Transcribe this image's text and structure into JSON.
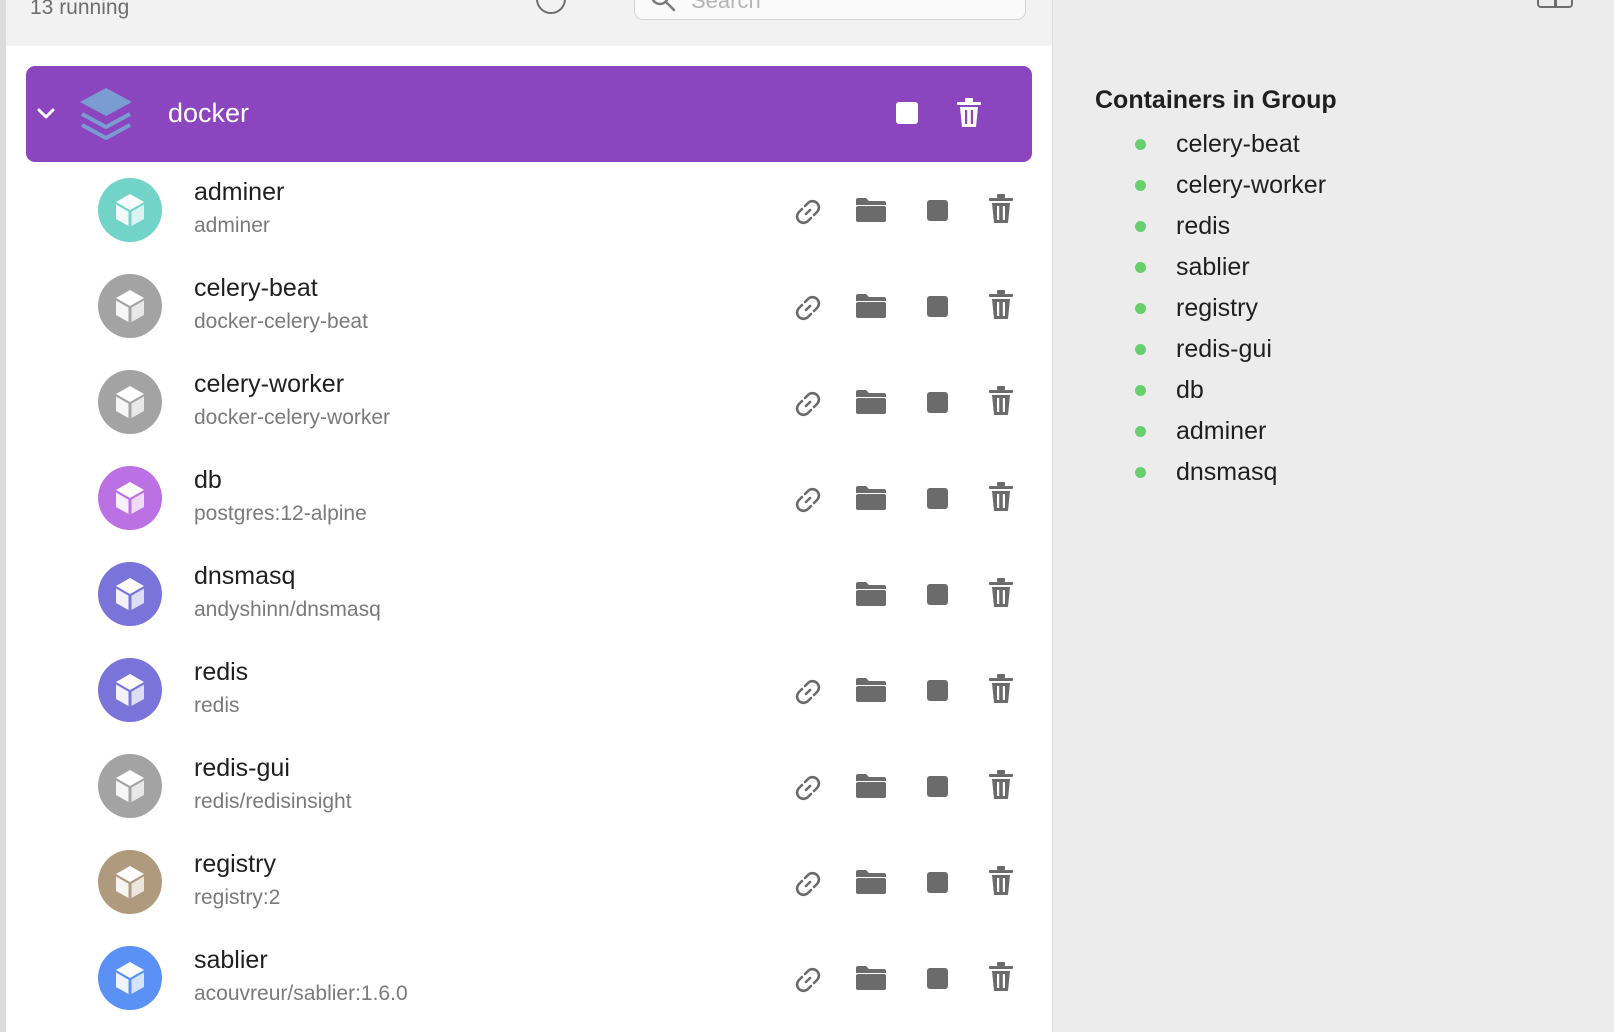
{
  "toolbar": {
    "running_label": "13 running",
    "search_placeholder": "Search",
    "filter_icon": "filter-icon",
    "search_icon": "search-icon"
  },
  "group": {
    "name": "docker",
    "color": "#8b45bf",
    "chevron_icon": "chevron-down-icon",
    "stack_icon": "stack-layers-icon"
  },
  "containers": [
    {
      "name": "adminer",
      "image": "adminer",
      "color": "#72d4c9",
      "has_link": true
    },
    {
      "name": "celery-beat",
      "image": "docker-celery-beat",
      "color": "#a3a3a3",
      "has_link": true
    },
    {
      "name": "celery-worker",
      "image": "docker-celery-worker",
      "color": "#a3a3a3",
      "has_link": true
    },
    {
      "name": "db",
      "image": "postgres:12-alpine",
      "color": "#bb71e3",
      "has_link": true
    },
    {
      "name": "dnsmasq",
      "image": "andyshinn/dnsmasq",
      "color": "#7a73da",
      "has_link": false
    },
    {
      "name": "redis",
      "image": "redis",
      "color": "#7a73da",
      "has_link": true
    },
    {
      "name": "redis-gui",
      "image": "redis/redisinsight",
      "color": "#a3a3a3",
      "has_link": true
    },
    {
      "name": "registry",
      "image": "registry:2",
      "color": "#b09a7e",
      "has_link": true
    },
    {
      "name": "sablier",
      "image": "acouvreur/sablier:1.6.0",
      "color": "#5b91f5",
      "has_link": true
    }
  ],
  "details": {
    "title": "Containers in Group",
    "status_color": "#67cf6d",
    "members": [
      "celery-beat",
      "celery-worker",
      "redis",
      "sablier",
      "registry",
      "redis-gui",
      "db",
      "adminer",
      "dnsmasq"
    ]
  }
}
